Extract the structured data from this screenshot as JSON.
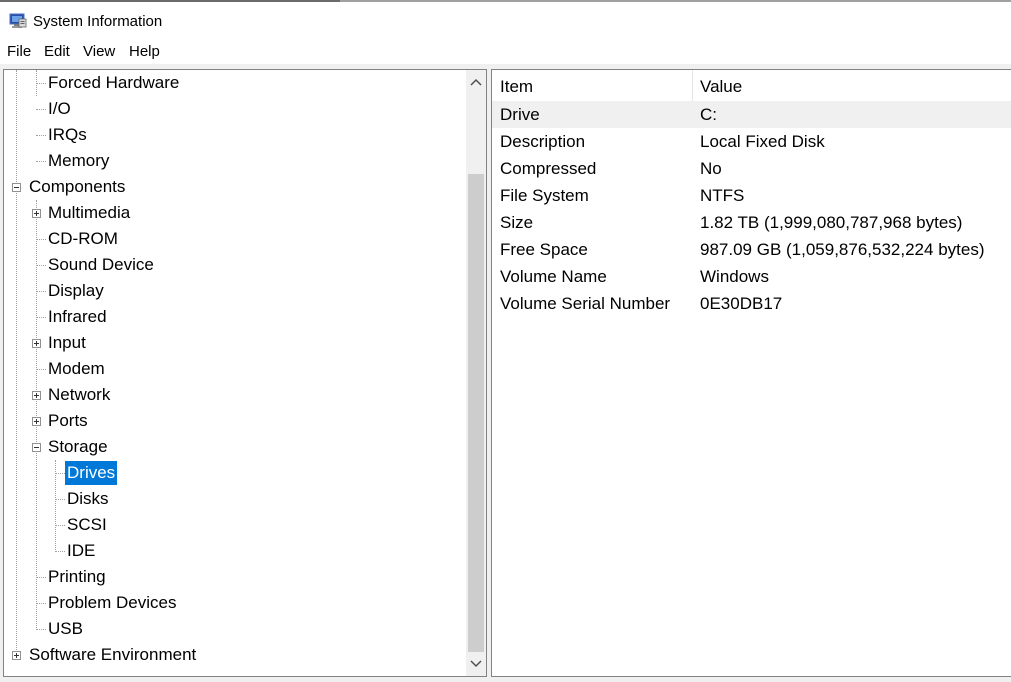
{
  "window": {
    "title": "System Information",
    "icon": "system-information-icon"
  },
  "menu": [
    {
      "label": "File"
    },
    {
      "label": "Edit"
    },
    {
      "label": "View"
    },
    {
      "label": "Help"
    }
  ],
  "tree": [
    {
      "label": "Forced Hardware"
    },
    {
      "label": "I/O"
    },
    {
      "label": "IRQs"
    },
    {
      "label": "Memory"
    },
    {
      "label": "Components",
      "expander": "collapse"
    },
    {
      "label": "Multimedia",
      "expander": "expand"
    },
    {
      "label": "CD-ROM"
    },
    {
      "label": "Sound Device"
    },
    {
      "label": "Display"
    },
    {
      "label": "Infrared"
    },
    {
      "label": "Input",
      "expander": "expand"
    },
    {
      "label": "Modem"
    },
    {
      "label": "Network",
      "expander": "expand"
    },
    {
      "label": "Ports",
      "expander": "expand"
    },
    {
      "label": "Storage",
      "expander": "collapse"
    },
    {
      "label": "Drives",
      "selected": true
    },
    {
      "label": "Disks"
    },
    {
      "label": "SCSI"
    },
    {
      "label": "IDE"
    },
    {
      "label": "Printing"
    },
    {
      "label": "Problem Devices"
    },
    {
      "label": "USB"
    },
    {
      "label": "Software Environment",
      "expander": "expand"
    }
  ],
  "table": {
    "columns": [
      "Item",
      "Value"
    ],
    "rows": [
      {
        "item": "Drive",
        "value": "C:"
      },
      {
        "item": "Description",
        "value": "Local Fixed Disk"
      },
      {
        "item": "Compressed",
        "value": "No"
      },
      {
        "item": "File System",
        "value": "NTFS"
      },
      {
        "item": "Size",
        "value": "1.82 TB (1,999,080,787,968 bytes)"
      },
      {
        "item": "Free Space",
        "value": "987.09 GB (1,059,876,532,224 bytes)"
      },
      {
        "item": "Volume Name",
        "value": "Windows"
      },
      {
        "item": "Volume Serial Number",
        "value": "0E30DB17"
      }
    ]
  },
  "colors": {
    "selection": "#0078d7",
    "row_highlight": "#f0f0f0"
  }
}
